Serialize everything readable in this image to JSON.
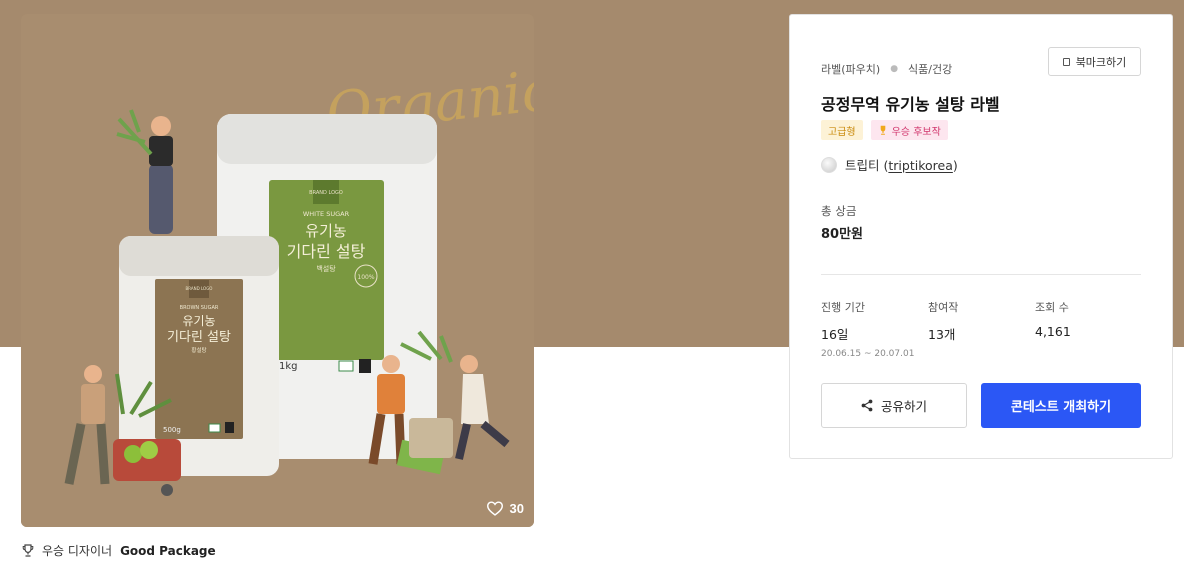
{
  "hero": {
    "bg_color": "#a58a6d",
    "image_alt": "공정무역 유기농 설탕 라벨 디자인",
    "image_texts": {
      "script_word": "Organic",
      "large_brand": "BRAND\nLOGO",
      "large_sub": "WHITE SUGAR",
      "large_title_1": "유기농",
      "large_title_2": "기다린 설탕",
      "large_variant": "백설탕",
      "large_weight": "1kg",
      "small_brand": "BRAND\nLOGO",
      "small_sub": "BROWN SUGAR",
      "small_title_1": "유기농",
      "small_title_2": "기다린 설탕",
      "small_variant": "황설탕",
      "small_weight": "500g",
      "badge_text": "100%"
    },
    "likes": "30",
    "heart_icon": "heart-icon"
  },
  "winner": {
    "icon": "trophy-icon",
    "prefix": "우승 디자이너",
    "name": "Good Package"
  },
  "panel": {
    "category": "라벨(파우치)",
    "subcategory": "식품/건강",
    "bookmark_label": "북마크하기",
    "title": "공정무역 유기농 설탕 라벨",
    "badge_grade": "고급형",
    "badge_award": "우승 후보작",
    "author_text": "트립티",
    "author_handle": "triptikorea",
    "prize_label": "총 상금",
    "prize_value": "80만원",
    "stats": [
      {
        "label": "진행 기간",
        "value": "16일",
        "sub": "20.06.15 ~ 20.07.01"
      },
      {
        "label": "참여작",
        "value": "13개",
        "sub": ""
      },
      {
        "label": "조회 수",
        "value": "4,161",
        "sub": ""
      }
    ],
    "share_label": "공유하기",
    "host_label": "콘테스트 개최하기",
    "accent_color": "#2b57f5"
  }
}
